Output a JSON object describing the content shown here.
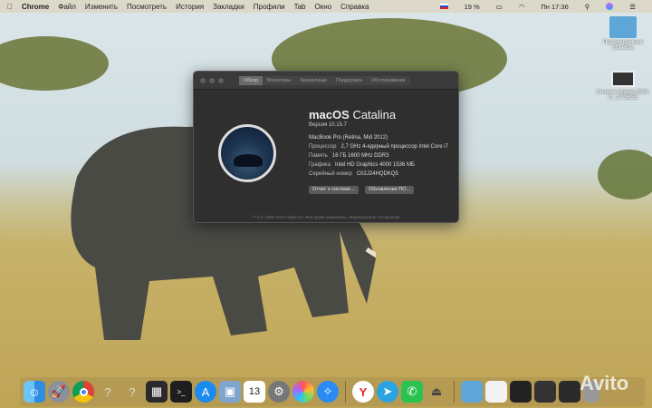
{
  "menubar": {
    "app": "Chrome",
    "items": [
      "Файл",
      "Изменить",
      "Посмотреть",
      "История",
      "Закладки",
      "Профили",
      "Tab",
      "Окно",
      "Справка"
    ],
    "battery": "19 %",
    "clock": "Пн 17:36"
  },
  "window": {
    "tabs": [
      "Обзор",
      "Мониторы",
      "Хранилище",
      "Поддержка",
      "Обслуживание"
    ],
    "os_name_bold": "macOS",
    "os_name": "Catalina",
    "version": "Версия 10.15.7",
    "model": "MacBook Pro (Retina, Mid 2012)",
    "specs": [
      {
        "k": "Процессор",
        "v": "2,7 GHz 4-ядерный процессор Intel Core i7"
      },
      {
        "k": "Память",
        "v": "16 ГБ 1600 MHz DDR3"
      },
      {
        "k": "Графика",
        "v": "Intel HD Graphics 4000 1536 МБ"
      },
      {
        "k": "Серийный номер",
        "v": "C02J24HQDKQ5"
      }
    ],
    "btn_report": "Отчет о системе...",
    "btn_update": "Обновление ПО...",
    "footer": "™ и © 1983–2022 Apple Inc. Все права защищены. Лицензионное соглашение"
  },
  "desktop": {
    "folder": "Перемещенные объекты",
    "screenshot": "Снимок экрана 2024-0...17.36.53"
  },
  "dock": [
    "finder",
    "launchpad",
    "chrome",
    "unknown-app",
    "unknown-app",
    "mission-control",
    "terminal",
    "app-store",
    "preview",
    "calendar",
    "system-preferences",
    "photos",
    "safari",
    "yandex",
    "telegram",
    "whatsapp",
    "airdrop",
    "folder",
    "document",
    "screenshot",
    "screenshot",
    "screenshot",
    "trash"
  ],
  "calendar_day": "13",
  "watermark": "Avito"
}
